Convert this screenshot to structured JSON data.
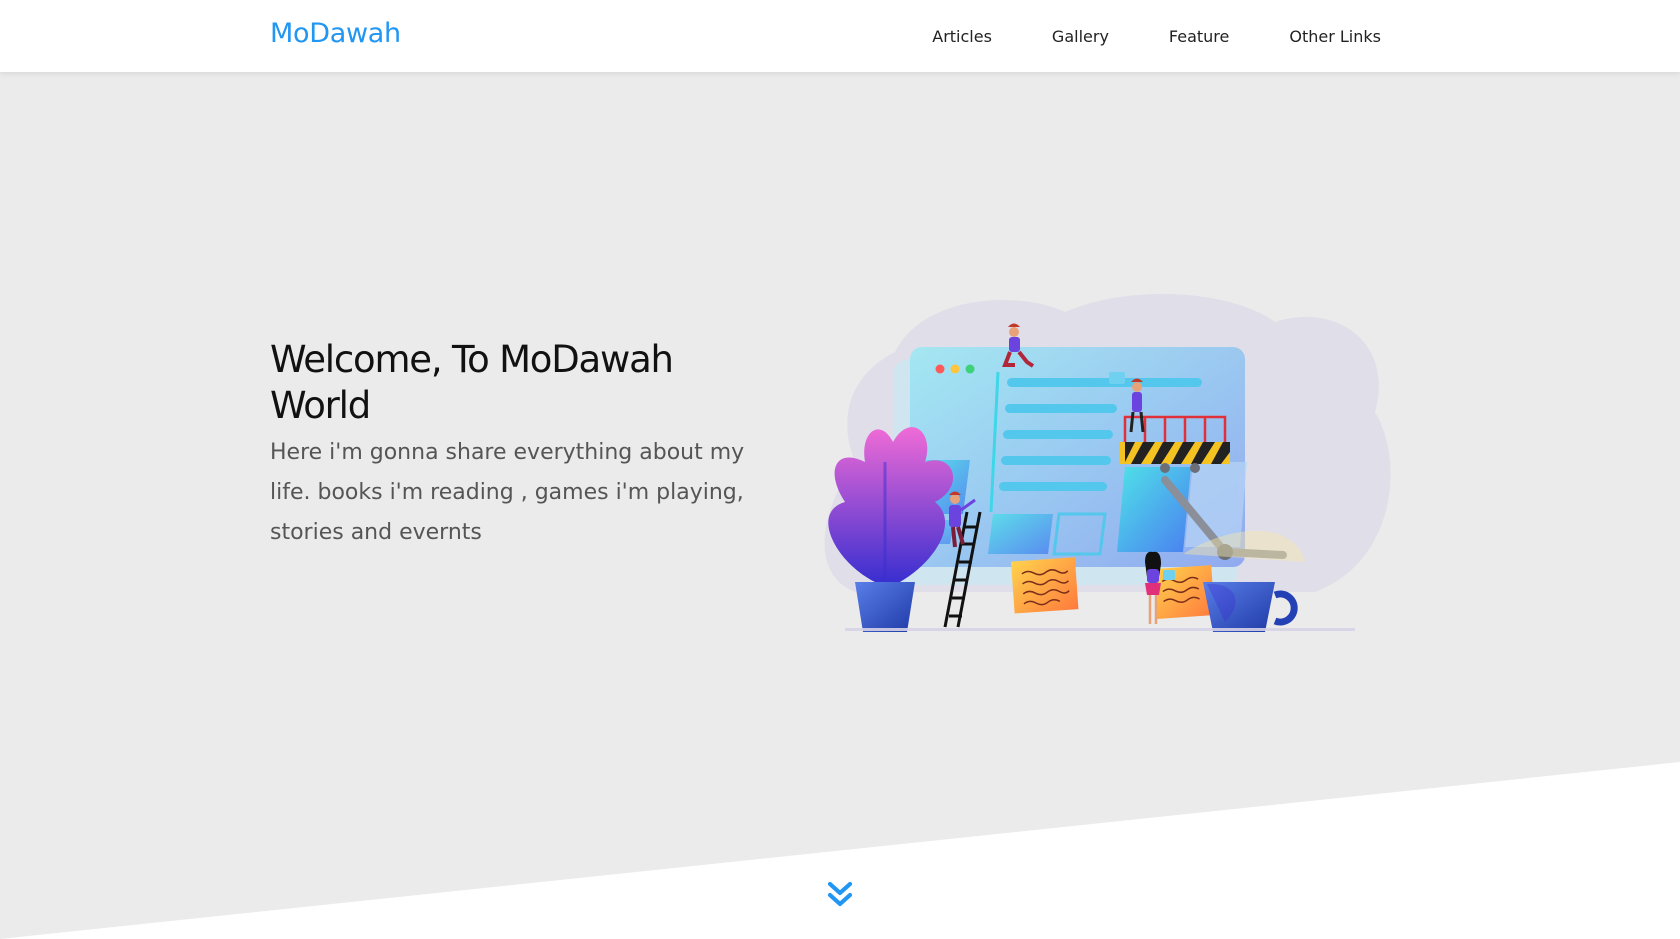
{
  "header": {
    "logo": "MoDawah",
    "nav": [
      {
        "label": "Articles"
      },
      {
        "label": "Gallery"
      },
      {
        "label": "Feature"
      },
      {
        "label": "Other Links"
      }
    ]
  },
  "landing": {
    "title": "Welcome, To MoDawah World",
    "subtitle": "Here i'm gonna share everything about my life. books i'm reading , games i'm playing, stories and evernts",
    "illustration": "website-building-illustration",
    "scroll_icon": "double-chevron-down-icon"
  },
  "colors": {
    "brand": "#2196f3",
    "landing_bg": "#ebebeb",
    "header_bg": "#ffffff",
    "text_dark": "#111111",
    "text_muted": "#555555"
  }
}
